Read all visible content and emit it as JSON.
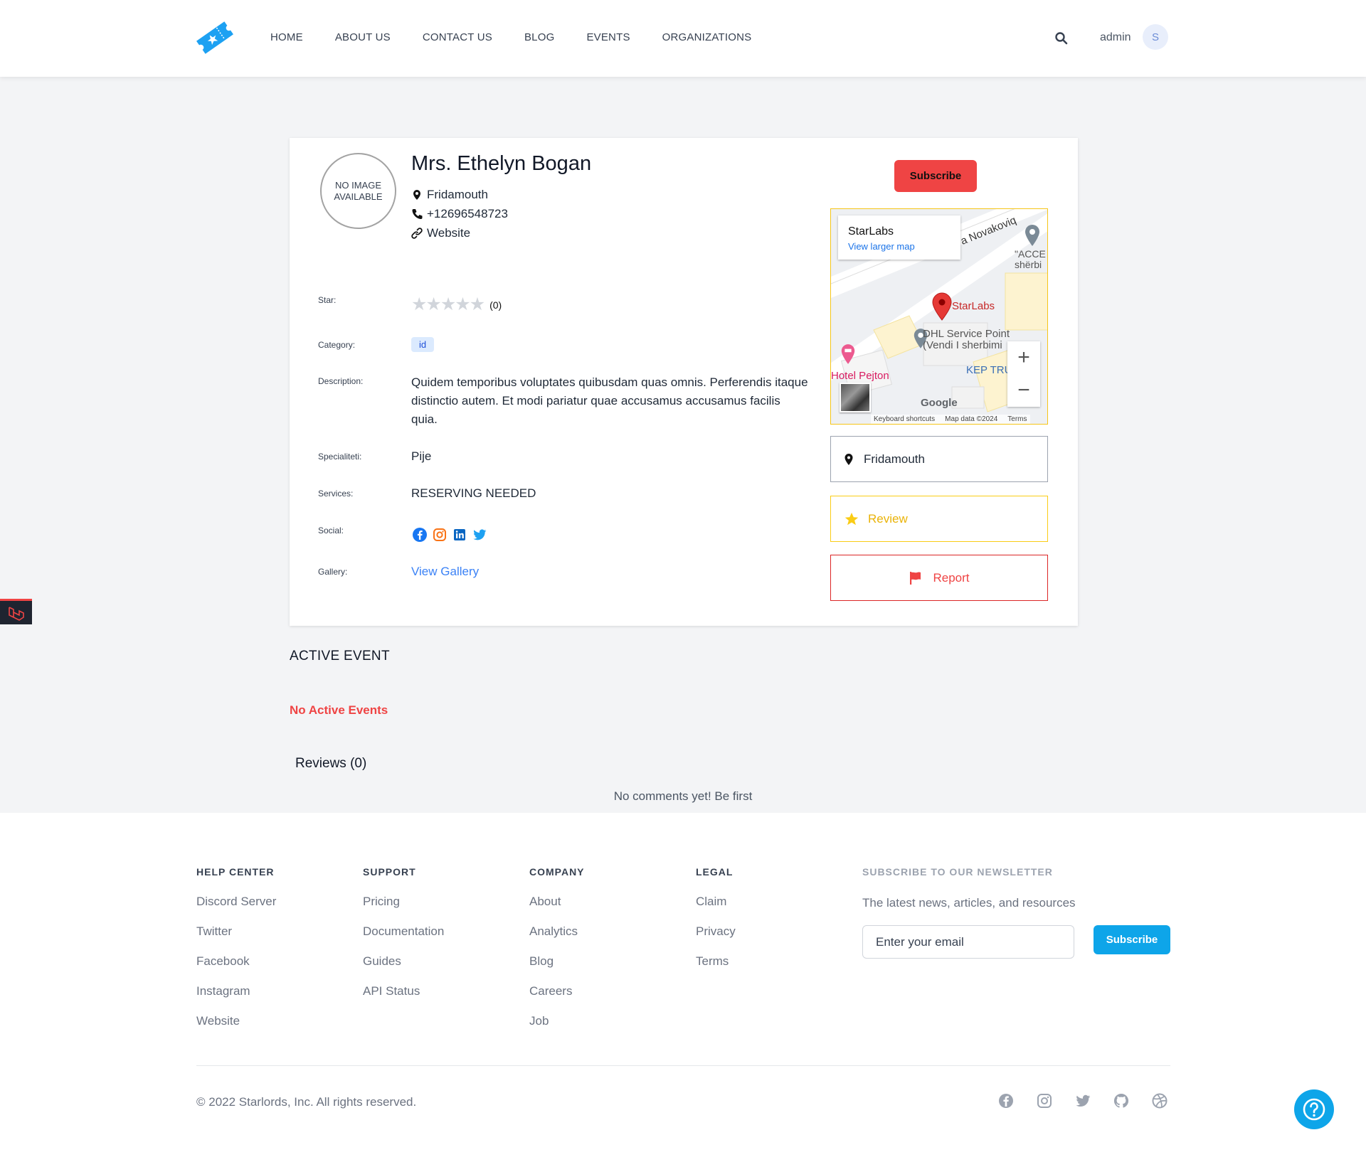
{
  "header": {
    "nav": [
      "HOME",
      "ABOUT US",
      "CONTACT US",
      "BLOG",
      "EVENTS",
      "ORGANIZATIONS"
    ],
    "user_name": "admin",
    "avatar_initial": "S"
  },
  "profile": {
    "no_image": "NO IMAGE AVAILABLE",
    "name": "Mrs. Ethelyn Bogan",
    "location": "Fridamouth",
    "phone": "+12696548723",
    "website_label": "Website",
    "labels": {
      "star": "Star:",
      "category": "Category:",
      "description": "Description:",
      "speciality": "Specialiteti:",
      "services": "Services:",
      "social": "Social:",
      "gallery": "Gallery:"
    },
    "rating_count": "(0)",
    "rating_value": 0,
    "category_tag": "id",
    "description": "Quidem temporibus voluptates quibusdam quas omnis. Perferendis itaque distinctio autem. Et modi pariatur quae accusamus accusamus facilis quia.",
    "speciality": "Pije",
    "services": "RESERVING NEEDED",
    "gallery_link": "View Gallery"
  },
  "sidebar": {
    "subscribe_label": "Subscribe",
    "location": "Fridamouth",
    "review_label": "Review",
    "report_label": "Report"
  },
  "map": {
    "place_title": "StarLabs",
    "larger_map_link": "View larger map",
    "street": "a Novakoviq",
    "marker_label": "StarLabs",
    "poi_dhl": "DHL Service Point",
    "poi_dhl_sub": "(Vendi I sherbimi",
    "poi_hotel": "Hotel Pejton",
    "poi_kep": "KEP TRU",
    "poi_acce": "\"ACCE",
    "poi_acce_sub": "shërbi",
    "google": "Google",
    "footer_shortcuts": "Keyboard shortcuts",
    "footer_data": "Map data ©2024",
    "footer_terms": "Terms",
    "zoom_in": "+",
    "zoom_out": "−"
  },
  "events": {
    "title": "ACTIVE EVENT",
    "empty": "No Active Events"
  },
  "reviews": {
    "title": "Reviews (0)",
    "empty": "No comments yet! Be first"
  },
  "footer": {
    "columns": [
      {
        "title": "HELP CENTER",
        "links": [
          "Discord Server",
          "Twitter",
          "Facebook",
          "Instagram",
          "Website"
        ]
      },
      {
        "title": "SUPPORT",
        "links": [
          "Pricing",
          "Documentation",
          "Guides",
          "API Status"
        ]
      },
      {
        "title": "COMPANY",
        "links": [
          "About",
          "Analytics",
          "Blog",
          "Careers",
          "Job"
        ]
      },
      {
        "title": "LEGAL",
        "links": [
          "Claim",
          "Privacy",
          "Terms"
        ]
      }
    ],
    "newsletter_title": "SUBSCRIBE TO OUR NEWSLETTER",
    "newsletter_text": "The latest news, articles, and resources",
    "email_placeholder": "Enter your email",
    "subscribe_label": "Subscribe",
    "copyright": "© 2022 Starlords, Inc. All rights reserved."
  },
  "colors": {
    "brand": "#1da1f2",
    "danger": "#ef4444",
    "warning": "#eab308",
    "accent": "#0ea5e9"
  }
}
